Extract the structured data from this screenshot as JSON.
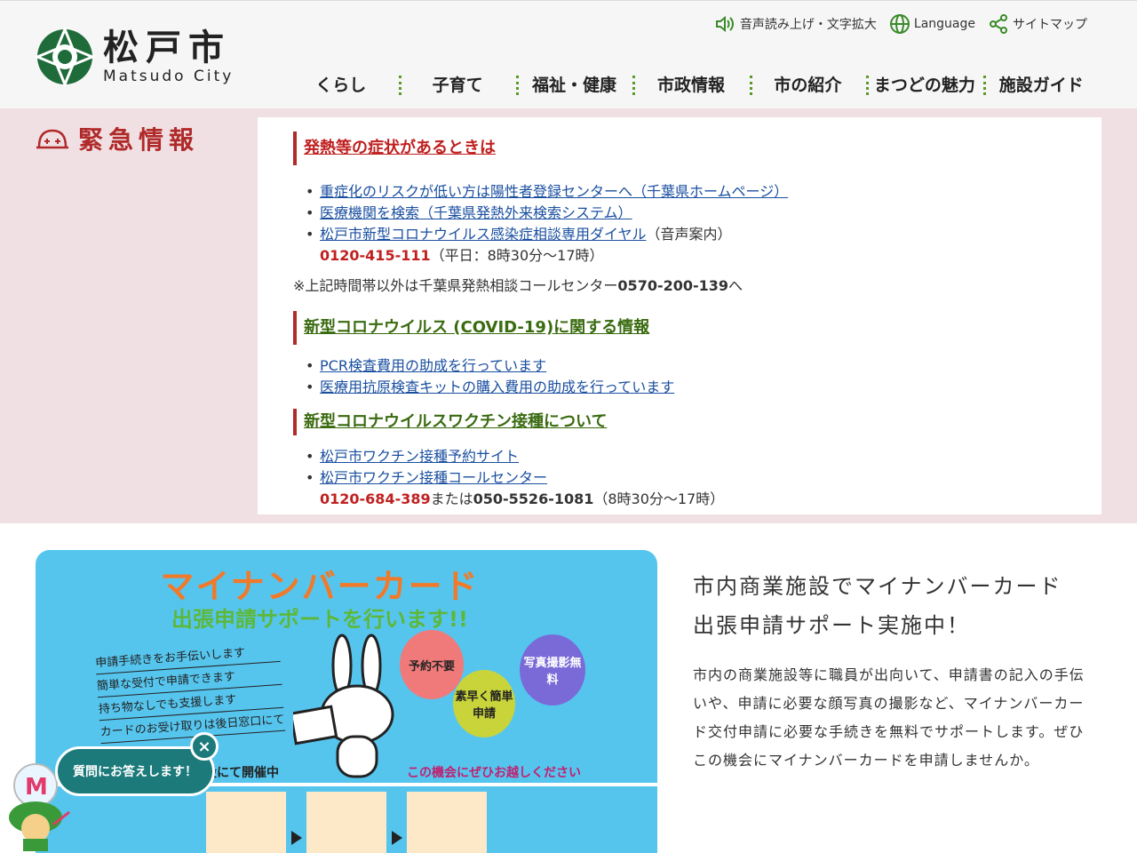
{
  "header": {
    "logo_jp": "松戸市",
    "logo_en": "Matsudo City",
    "utility": [
      {
        "label": "音声読み上げ・文字拡大",
        "icon": "speaker-icon"
      },
      {
        "label": "Language",
        "icon": "globe-icon"
      },
      {
        "label": "サイトマップ",
        "icon": "share-icon"
      }
    ],
    "nav": [
      "くらし",
      "子育て",
      "福祉・健康",
      "市政情報",
      "市の紹介",
      "まつどの魅力",
      "施設ガイド"
    ]
  },
  "emergency": {
    "title": "緊急情報",
    "sections": [
      {
        "heading": "発熱等の症状があるときは",
        "links": [
          "重症化のリスクが低い方は陽性者登録センターへ（千葉県ホームページ）",
          "医療機関を検索（千葉県発熱外来検索システム）",
          "松戸市新型コロナウイルス感染症相談専用ダイヤル"
        ],
        "link3_suffix": "（音声案内）",
        "phone": "0120-415-111",
        "phone_hours": "（平日：8時30分～17時）",
        "note_prefix": "※上記時間帯以外は千葉県発熱相談コールセンター",
        "note_phone": "0570-200-139",
        "note_suffix": "へ"
      },
      {
        "heading": "新型コロナウイルス (COVID-19)に関する情報",
        "links": [
          "PCR検査費用の助成を行っています",
          "医療用抗原検査キットの購入費用の助成を行っています"
        ]
      },
      {
        "heading": "新型コロナウイルスワクチン接種について",
        "links": [
          "松戸市ワクチン接種予約サイト",
          "松戸市ワクチン接種コールセンター"
        ],
        "phone1": "0120-684-389",
        "phone_or": "または",
        "phone2": "050-5526-1081",
        "phone_hours": "（8時30分～17時）"
      }
    ]
  },
  "banner": {
    "title": "マイナンバーカード",
    "subtitle": "出張申請サポートを行います!!",
    "points": [
      "申請手続きをお手伝いします",
      "簡単な受付で申請できます",
      "持ち物なしでも支援します",
      "カードのお受け取りは後日窓口にて"
    ],
    "balloons": [
      "予約不要",
      "素早く簡単申請",
      "写真撮影無料"
    ],
    "open_text": "設にて開催中",
    "cta": "この機会にぜひお越しください"
  },
  "info": {
    "title_line1": "市内商業施設でマイナンバーカード",
    "title_line2": "出張申請サポート実施中！",
    "body": "市内の商業施設等に職員が出向いて、申請書の記入の手伝いや、申請に必要な顔写真の撮影など、マイナンバーカード交付申請に必要な手続きを無料でサポートします。ぜひこの機会にマイナンバーカードを申請しませんか。"
  },
  "chat": {
    "label": "質問にお答えします！",
    "close": "×"
  },
  "colors": {
    "brand_green": "#1f6b3a",
    "emergency_red": "#b02a2a",
    "emergency_bg": "#f1e0e3",
    "link_blue": "#1a4fa0",
    "chat_teal": "#1c7a7a"
  }
}
